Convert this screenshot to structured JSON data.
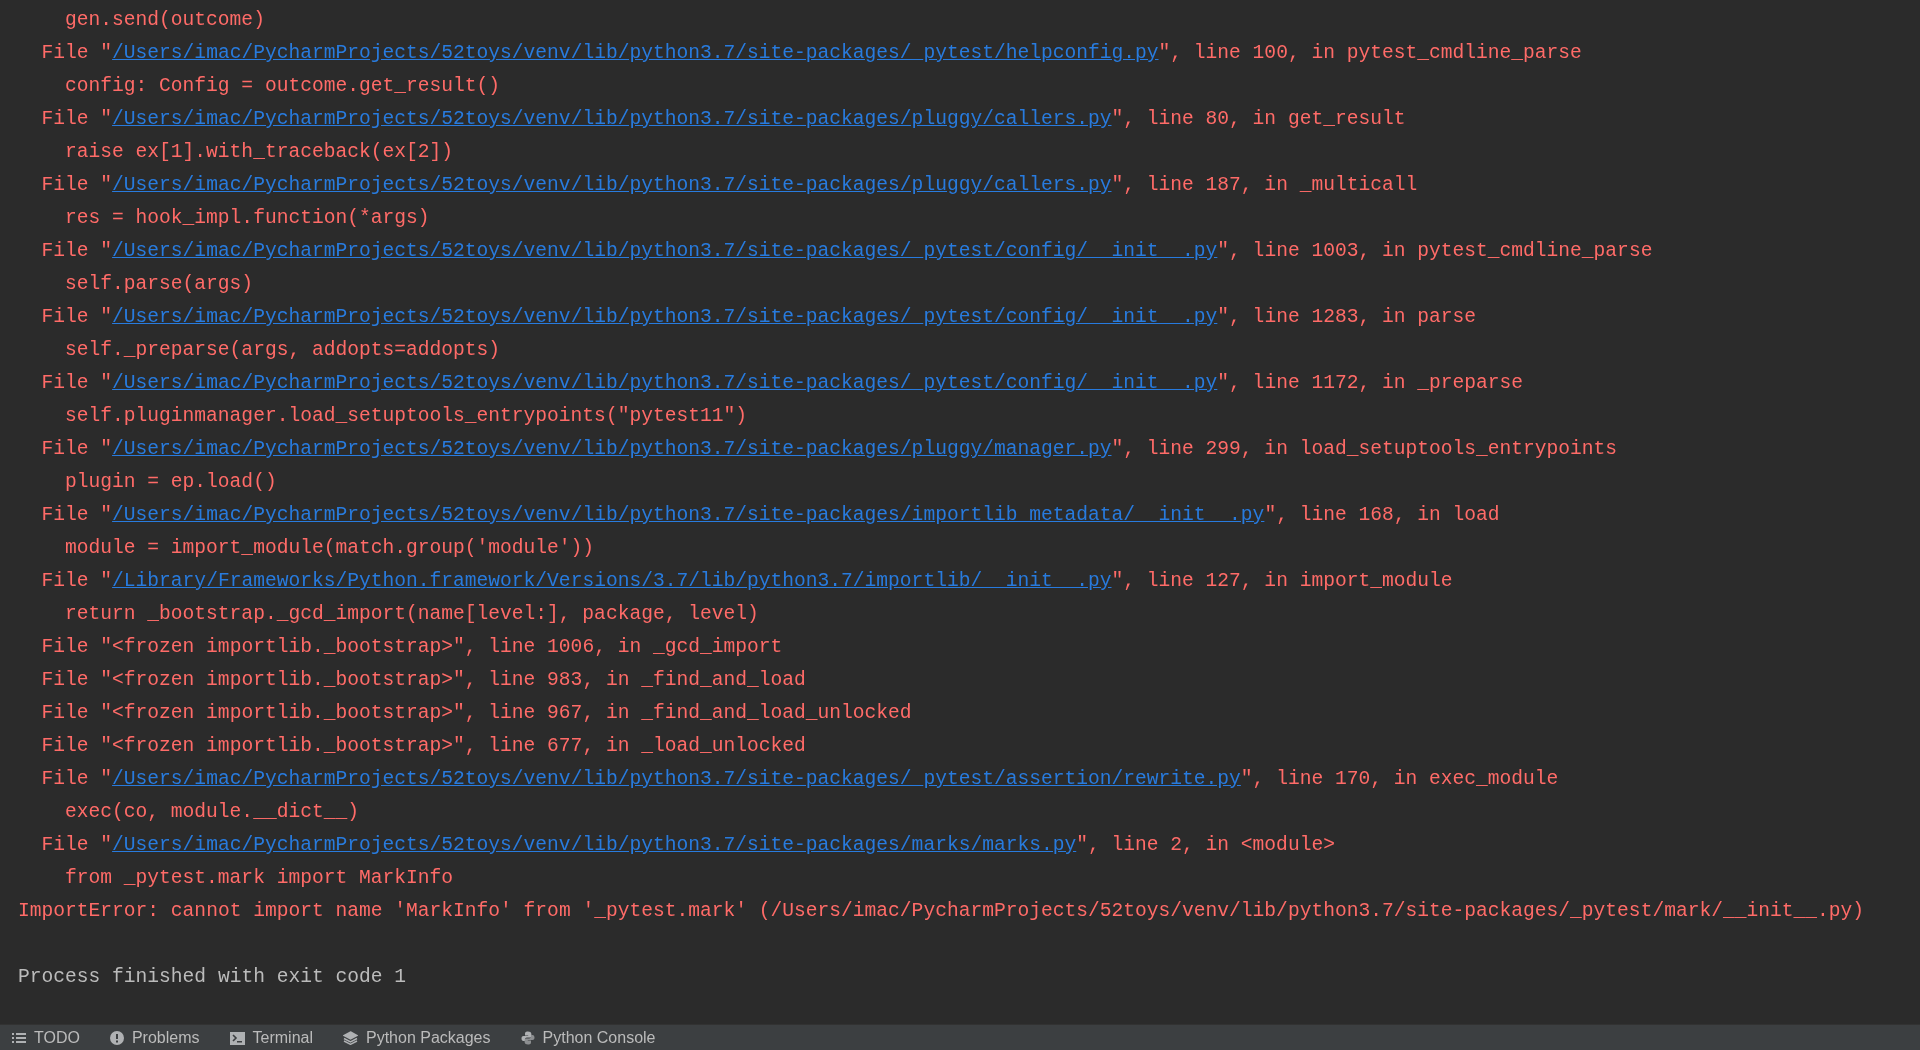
{
  "console": {
    "lines": [
      {
        "kind": "source",
        "text": "gen.send(outcome)"
      },
      {
        "kind": "frame",
        "prefix": "File \"",
        "path": "/Users/imac/PycharmProjects/52toys/venv/lib/python3.7/site-packages/_pytest/helpconfig.py",
        "suffix": "\", line 100, in pytest_cmdline_parse"
      },
      {
        "kind": "source",
        "text": "config: Config = outcome.get_result()"
      },
      {
        "kind": "frame",
        "prefix": "File \"",
        "path": "/Users/imac/PycharmProjects/52toys/venv/lib/python3.7/site-packages/pluggy/callers.py",
        "suffix": "\", line 80, in get_result"
      },
      {
        "kind": "source",
        "text": "raise ex[1].with_traceback(ex[2])"
      },
      {
        "kind": "frame",
        "prefix": "File \"",
        "path": "/Users/imac/PycharmProjects/52toys/venv/lib/python3.7/site-packages/pluggy/callers.py",
        "suffix": "\", line 187, in _multicall"
      },
      {
        "kind": "source",
        "text": "res = hook_impl.function(*args)"
      },
      {
        "kind": "frame",
        "prefix": "File \"",
        "path": "/Users/imac/PycharmProjects/52toys/venv/lib/python3.7/site-packages/_pytest/config/__init__.py",
        "suffix": "\", line 1003, in pytest_cmdline_parse"
      },
      {
        "kind": "source",
        "text": "self.parse(args)"
      },
      {
        "kind": "frame",
        "prefix": "File \"",
        "path": "/Users/imac/PycharmProjects/52toys/venv/lib/python3.7/site-packages/_pytest/config/__init__.py",
        "suffix": "\", line 1283, in parse"
      },
      {
        "kind": "source",
        "text": "self._preparse(args, addopts=addopts)"
      },
      {
        "kind": "frame",
        "prefix": "File \"",
        "path": "/Users/imac/PycharmProjects/52toys/venv/lib/python3.7/site-packages/_pytest/config/__init__.py",
        "suffix": "\", line 1172, in _preparse"
      },
      {
        "kind": "source",
        "text": "self.pluginmanager.load_setuptools_entrypoints(\"pytest11\")"
      },
      {
        "kind": "frame",
        "prefix": "File \"",
        "path": "/Users/imac/PycharmProjects/52toys/venv/lib/python3.7/site-packages/pluggy/manager.py",
        "suffix": "\", line 299, in load_setuptools_entrypoints"
      },
      {
        "kind": "source",
        "text": "plugin = ep.load()"
      },
      {
        "kind": "frame",
        "prefix": "File \"",
        "path": "/Users/imac/PycharmProjects/52toys/venv/lib/python3.7/site-packages/importlib_metadata/__init__.py",
        "suffix": "\", line 168, in load"
      },
      {
        "kind": "source",
        "text": "module = import_module(match.group('module'))"
      },
      {
        "kind": "frame",
        "prefix": "File \"",
        "path": "/Library/Frameworks/Python.framework/Versions/3.7/lib/python3.7/importlib/__init__.py",
        "suffix": "\", line 127, in import_module"
      },
      {
        "kind": "source",
        "text": "return _bootstrap._gcd_import(name[level:], package, level)"
      },
      {
        "kind": "frame",
        "text": "File \"<frozen importlib._bootstrap>\", line 1006, in _gcd_import"
      },
      {
        "kind": "frame",
        "text": "File \"<frozen importlib._bootstrap>\", line 983, in _find_and_load"
      },
      {
        "kind": "frame",
        "text": "File \"<frozen importlib._bootstrap>\", line 967, in _find_and_load_unlocked"
      },
      {
        "kind": "frame",
        "text": "File \"<frozen importlib._bootstrap>\", line 677, in _load_unlocked"
      },
      {
        "kind": "frame",
        "prefix": "File \"",
        "path": "/Users/imac/PycharmProjects/52toys/venv/lib/python3.7/site-packages/_pytest/assertion/rewrite.py",
        "suffix": "\", line 170, in exec_module"
      },
      {
        "kind": "source",
        "text": "exec(co, module.__dict__)"
      },
      {
        "kind": "frame",
        "prefix": "File \"",
        "path": "/Users/imac/PycharmProjects/52toys/venv/lib/python3.7/site-packages/marks/marks.py",
        "suffix": "\", line 2, in <module>"
      },
      {
        "kind": "source",
        "text": "from _pytest.mark import MarkInfo"
      },
      {
        "kind": "error",
        "text": "ImportError: cannot import name 'MarkInfo' from '_pytest.mark' (/Users/imac/PycharmProjects/52toys/venv/lib/python3.7/site-packages/_pytest/mark/__init__.py)"
      },
      {
        "kind": "blank"
      },
      {
        "kind": "info",
        "text": "Process finished with exit code 1"
      }
    ]
  },
  "tool_window_bar": {
    "tabs": [
      {
        "kind": "todo",
        "label": "TODO"
      },
      {
        "kind": "problems",
        "label": "Problems"
      },
      {
        "kind": "terminal",
        "label": "Terminal"
      },
      {
        "kind": "packages",
        "label": "Python Packages"
      },
      {
        "kind": "console",
        "label": "Python Console"
      }
    ]
  }
}
